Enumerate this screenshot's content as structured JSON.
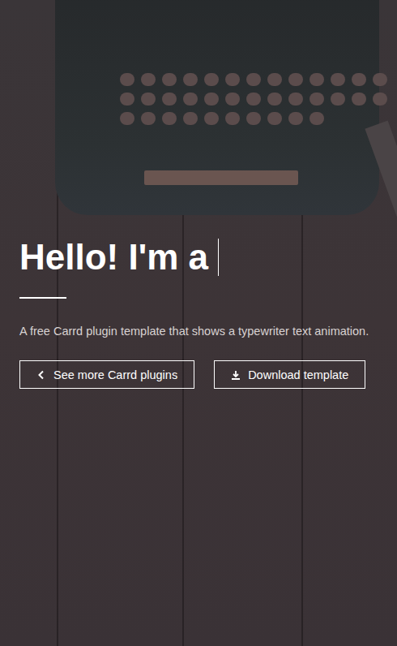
{
  "heading": {
    "text": "Hello! I'm a",
    "cursor": true
  },
  "description": "A free Carrd plugin template that shows a typewriter text animation.",
  "buttons": [
    {
      "label": "See more Carrd plugins",
      "kind": "back"
    },
    {
      "label": "Download template",
      "kind": "download"
    }
  ]
}
